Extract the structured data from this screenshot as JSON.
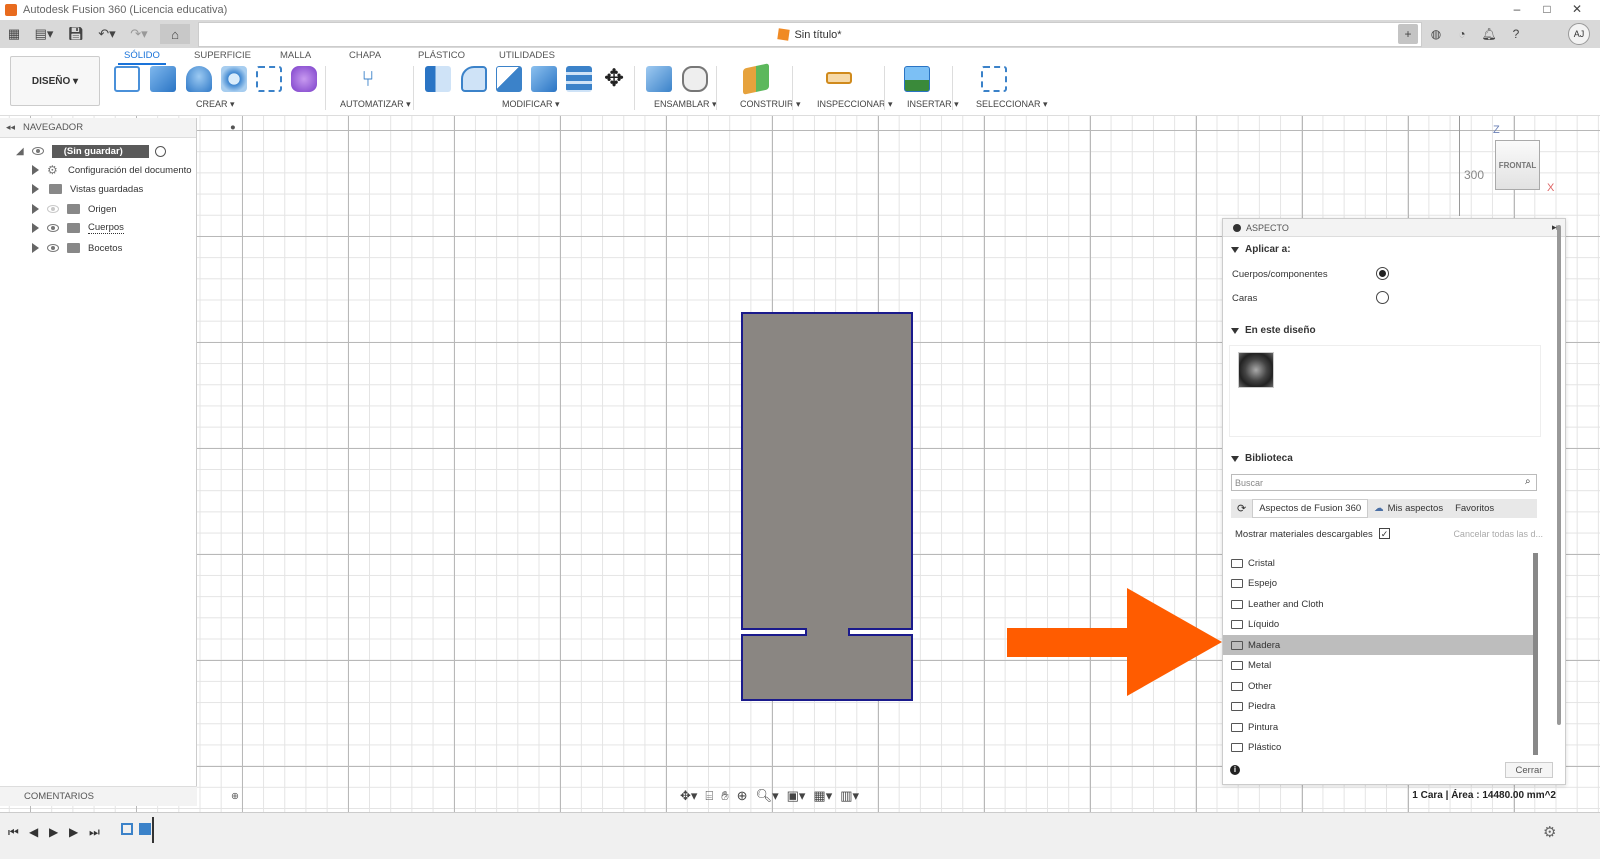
{
  "window": {
    "title": "Autodesk Fusion 360 (Licencia educativa)"
  },
  "document": {
    "tab_title": "Sin título*"
  },
  "user": {
    "initials": "AJ"
  },
  "ribbon": {
    "workspace": "DISEÑO ▾",
    "tabs": [
      "SÓLIDO",
      "SUPERFICIE",
      "MALLA",
      "CHAPA",
      "PLÁSTICO",
      "UTILIDADES"
    ],
    "groups": [
      "CREAR ▾",
      "AUTOMATIZAR ▾",
      "MODIFICAR ▾",
      "ENSAMBLAR ▾",
      "CONSTRUIR ▾",
      "INSPECCIONAR ▾",
      "INSERTAR ▾",
      "SELECCIONAR ▾"
    ]
  },
  "navigator": {
    "title": "NAVEGADOR",
    "root": "(Sin guardar)",
    "items": [
      "Configuración del documento",
      "Vistas guardadas",
      "Origen",
      "Cuerpos",
      "Bocetos"
    ]
  },
  "comments": {
    "title": "COMENTARIOS"
  },
  "viewcube": {
    "face": "FRONTAL",
    "axis_z": "Z",
    "axis_x": "X",
    "scale_label": "300"
  },
  "aspect_panel": {
    "title": "ASPECTO",
    "apply_to": {
      "heading": "Aplicar a:",
      "options": [
        "Cuerpos/componentes",
        "Caras"
      ],
      "selected": "Cuerpos/componentes"
    },
    "in_design": {
      "heading": "En este diseño"
    },
    "library": {
      "heading": "Biblioteca",
      "search_placeholder": "Buscar",
      "tabs": [
        "Aspectos de Fusion 360",
        "Mis aspectos",
        "Favoritos"
      ],
      "show_downloadable": "Mostrar materiales descargables",
      "show_downloadable_checked": true,
      "cancel_all": "Cancelar todas las d...",
      "folders": [
        "Cristal",
        "Espejo",
        "Leather and Cloth",
        "Líquido",
        "Madera",
        "Metal",
        "Other",
        "Piedra",
        "Pintura",
        "Plástico"
      ],
      "selected_folder": "Madera"
    },
    "close_label": "Cerrar"
  },
  "status": {
    "selection_info": "1 Cara | Área : 14480.00 mm^2"
  },
  "colors": {
    "accent": "#1a73d9",
    "arrow": "#ff5c00",
    "body_fill": "#8a8682",
    "body_outline": "#1a1a8c"
  }
}
